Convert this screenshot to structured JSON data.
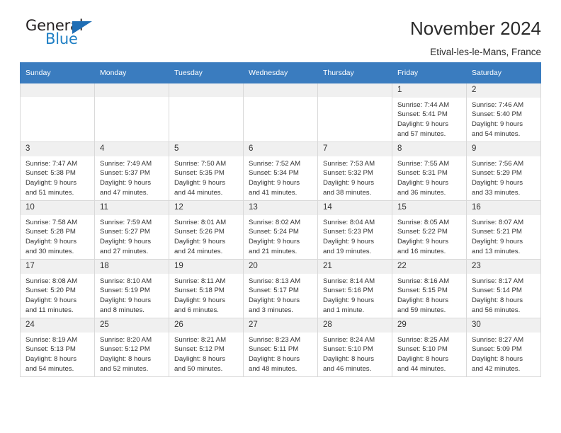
{
  "brand": {
    "name_top": "General",
    "name_bottom": "Blue",
    "triangle_color": "#1f6eb5",
    "blue_color": "#1f7fc4"
  },
  "header": {
    "title": "November 2024",
    "subtitle": "Etival-les-le-Mans, France",
    "header_bg": "#3a7cbf",
    "header_text_color": "#ffffff",
    "daynum_bg": "#f0f0f0"
  },
  "weekday_headers": [
    "Sunday",
    "Monday",
    "Tuesday",
    "Wednesday",
    "Thursday",
    "Friday",
    "Saturday"
  ],
  "labels": {
    "sunrise_prefix": "Sunrise:",
    "sunset_prefix": "Sunset:",
    "daylight_prefix": "Daylight:"
  },
  "weeks": [
    [
      {
        "day": "",
        "line1": "",
        "line2": "",
        "line3": "",
        "line4": ""
      },
      {
        "day": "",
        "line1": "",
        "line2": "",
        "line3": "",
        "line4": ""
      },
      {
        "day": "",
        "line1": "",
        "line2": "",
        "line3": "",
        "line4": ""
      },
      {
        "day": "",
        "line1": "",
        "line2": "",
        "line3": "",
        "line4": ""
      },
      {
        "day": "",
        "line1": "",
        "line2": "",
        "line3": "",
        "line4": ""
      },
      {
        "day": "1",
        "line1": "Sunrise: 7:44 AM",
        "line2": "Sunset: 5:41 PM",
        "line3": "Daylight: 9 hours",
        "line4": "and 57 minutes."
      },
      {
        "day": "2",
        "line1": "Sunrise: 7:46 AM",
        "line2": "Sunset: 5:40 PM",
        "line3": "Daylight: 9 hours",
        "line4": "and 54 minutes."
      }
    ],
    [
      {
        "day": "3",
        "line1": "Sunrise: 7:47 AM",
        "line2": "Sunset: 5:38 PM",
        "line3": "Daylight: 9 hours",
        "line4": "and 51 minutes."
      },
      {
        "day": "4",
        "line1": "Sunrise: 7:49 AM",
        "line2": "Sunset: 5:37 PM",
        "line3": "Daylight: 9 hours",
        "line4": "and 47 minutes."
      },
      {
        "day": "5",
        "line1": "Sunrise: 7:50 AM",
        "line2": "Sunset: 5:35 PM",
        "line3": "Daylight: 9 hours",
        "line4": "and 44 minutes."
      },
      {
        "day": "6",
        "line1": "Sunrise: 7:52 AM",
        "line2": "Sunset: 5:34 PM",
        "line3": "Daylight: 9 hours",
        "line4": "and 41 minutes."
      },
      {
        "day": "7",
        "line1": "Sunrise: 7:53 AM",
        "line2": "Sunset: 5:32 PM",
        "line3": "Daylight: 9 hours",
        "line4": "and 38 minutes."
      },
      {
        "day": "8",
        "line1": "Sunrise: 7:55 AM",
        "line2": "Sunset: 5:31 PM",
        "line3": "Daylight: 9 hours",
        "line4": "and 36 minutes."
      },
      {
        "day": "9",
        "line1": "Sunrise: 7:56 AM",
        "line2": "Sunset: 5:29 PM",
        "line3": "Daylight: 9 hours",
        "line4": "and 33 minutes."
      }
    ],
    [
      {
        "day": "10",
        "line1": "Sunrise: 7:58 AM",
        "line2": "Sunset: 5:28 PM",
        "line3": "Daylight: 9 hours",
        "line4": "and 30 minutes."
      },
      {
        "day": "11",
        "line1": "Sunrise: 7:59 AM",
        "line2": "Sunset: 5:27 PM",
        "line3": "Daylight: 9 hours",
        "line4": "and 27 minutes."
      },
      {
        "day": "12",
        "line1": "Sunrise: 8:01 AM",
        "line2": "Sunset: 5:26 PM",
        "line3": "Daylight: 9 hours",
        "line4": "and 24 minutes."
      },
      {
        "day": "13",
        "line1": "Sunrise: 8:02 AM",
        "line2": "Sunset: 5:24 PM",
        "line3": "Daylight: 9 hours",
        "line4": "and 21 minutes."
      },
      {
        "day": "14",
        "line1": "Sunrise: 8:04 AM",
        "line2": "Sunset: 5:23 PM",
        "line3": "Daylight: 9 hours",
        "line4": "and 19 minutes."
      },
      {
        "day": "15",
        "line1": "Sunrise: 8:05 AM",
        "line2": "Sunset: 5:22 PM",
        "line3": "Daylight: 9 hours",
        "line4": "and 16 minutes."
      },
      {
        "day": "16",
        "line1": "Sunrise: 8:07 AM",
        "line2": "Sunset: 5:21 PM",
        "line3": "Daylight: 9 hours",
        "line4": "and 13 minutes."
      }
    ],
    [
      {
        "day": "17",
        "line1": "Sunrise: 8:08 AM",
        "line2": "Sunset: 5:20 PM",
        "line3": "Daylight: 9 hours",
        "line4": "and 11 minutes."
      },
      {
        "day": "18",
        "line1": "Sunrise: 8:10 AM",
        "line2": "Sunset: 5:19 PM",
        "line3": "Daylight: 9 hours",
        "line4": "and 8 minutes."
      },
      {
        "day": "19",
        "line1": "Sunrise: 8:11 AM",
        "line2": "Sunset: 5:18 PM",
        "line3": "Daylight: 9 hours",
        "line4": "and 6 minutes."
      },
      {
        "day": "20",
        "line1": "Sunrise: 8:13 AM",
        "line2": "Sunset: 5:17 PM",
        "line3": "Daylight: 9 hours",
        "line4": "and 3 minutes."
      },
      {
        "day": "21",
        "line1": "Sunrise: 8:14 AM",
        "line2": "Sunset: 5:16 PM",
        "line3": "Daylight: 9 hours",
        "line4": "and 1 minute."
      },
      {
        "day": "22",
        "line1": "Sunrise: 8:16 AM",
        "line2": "Sunset: 5:15 PM",
        "line3": "Daylight: 8 hours",
        "line4": "and 59 minutes."
      },
      {
        "day": "23",
        "line1": "Sunrise: 8:17 AM",
        "line2": "Sunset: 5:14 PM",
        "line3": "Daylight: 8 hours",
        "line4": "and 56 minutes."
      }
    ],
    [
      {
        "day": "24",
        "line1": "Sunrise: 8:19 AM",
        "line2": "Sunset: 5:13 PM",
        "line3": "Daylight: 8 hours",
        "line4": "and 54 minutes."
      },
      {
        "day": "25",
        "line1": "Sunrise: 8:20 AM",
        "line2": "Sunset: 5:12 PM",
        "line3": "Daylight: 8 hours",
        "line4": "and 52 minutes."
      },
      {
        "day": "26",
        "line1": "Sunrise: 8:21 AM",
        "line2": "Sunset: 5:12 PM",
        "line3": "Daylight: 8 hours",
        "line4": "and 50 minutes."
      },
      {
        "day": "27",
        "line1": "Sunrise: 8:23 AM",
        "line2": "Sunset: 5:11 PM",
        "line3": "Daylight: 8 hours",
        "line4": "and 48 minutes."
      },
      {
        "day": "28",
        "line1": "Sunrise: 8:24 AM",
        "line2": "Sunset: 5:10 PM",
        "line3": "Daylight: 8 hours",
        "line4": "and 46 minutes."
      },
      {
        "day": "29",
        "line1": "Sunrise: 8:25 AM",
        "line2": "Sunset: 5:10 PM",
        "line3": "Daylight: 8 hours",
        "line4": "and 44 minutes."
      },
      {
        "day": "30",
        "line1": "Sunrise: 8:27 AM",
        "line2": "Sunset: 5:09 PM",
        "line3": "Daylight: 8 hours",
        "line4": "and 42 minutes."
      }
    ]
  ]
}
